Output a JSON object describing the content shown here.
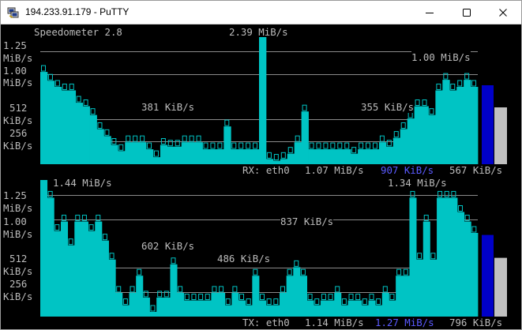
{
  "window": {
    "title": "194.233.91.179 - PuTTY",
    "icon": "putty-icon",
    "controls": [
      "minimize-icon",
      "maximize-icon",
      "close-icon"
    ]
  },
  "colors": {
    "background": "#000000",
    "text": "#bcbcbc",
    "bars": "#00c4c4",
    "gridline": "#8a8a8a",
    "meter_fill": "#0000c8",
    "meter_empty": "#c0c0c0",
    "highlight_blue": "#5555ff"
  },
  "header": {
    "app": "Speedometer 2.8",
    "peak": "2.39 MiB/s"
  },
  "scale_labels": {
    "rx": [
      "1.25",
      "MiB/s",
      "1.00",
      "MiB/s",
      "512",
      "KiB/s",
      "256",
      "KiB/s"
    ],
    "tx": [
      "1.25",
      "MiB/s",
      "1.00",
      "MiB/s",
      "512",
      "KiB/s",
      "256",
      "KiB/s"
    ]
  },
  "rx": {
    "annotations": [
      "381 KiB/s",
      "355 KiB/s",
      "1.00 MiB/s"
    ],
    "status": {
      "label": "RX: eth0",
      "current": "1.07 MiB/s",
      "average": "907 KiB/s",
      "min": "567 KiB/s"
    },
    "meter_level": 0.68
  },
  "tx": {
    "annotations": [
      "1.44 MiB/s",
      "1.34 MiB/s",
      "837 KiB/s",
      "602 KiB/s",
      "486 KiB/s"
    ],
    "status": {
      "label": "TX: eth0",
      "current": "1.14 MiB/s",
      "average": "1.27 MiB/s",
      "min": "796 KiB/s"
    },
    "meter_level": 0.65
  },
  "chart_data": [
    {
      "type": "bar",
      "name": "RX: eth0",
      "ylabel": "",
      "yticks": [
        "1.25 MiB/s",
        "1.00 MiB/s",
        "512 KiB/s",
        "256 KiB/s"
      ],
      "units": "KiB/s",
      "ylim": [
        0,
        1320
      ],
      "values": [
        1050,
        950,
        880,
        840,
        840,
        700,
        660,
        560,
        400,
        320,
        220,
        150,
        250,
        250,
        250,
        170,
        80,
        220,
        200,
        200,
        250,
        250,
        250,
        170,
        170,
        170,
        430,
        170,
        170,
        170,
        170,
        2448,
        60,
        40,
        60,
        120,
        250,
        600,
        170,
        170,
        170,
        170,
        170,
        170,
        120,
        170,
        170,
        170,
        250,
        200,
        300,
        400,
        520,
        660,
        660,
        560,
        840,
        960,
        840,
        880,
        960,
        880
      ]
    },
    {
      "type": "bar",
      "name": "TX: eth0",
      "ylabel": "",
      "yticks": [
        "1.25 MiB/s",
        "1.00 MiB/s",
        "512 KiB/s",
        "256 KiB/s"
      ],
      "units": "KiB/s",
      "ylim": [
        0,
        1320
      ],
      "values": [
        1474,
        1250,
        900,
        1000,
        750,
        1000,
        1000,
        900,
        1000,
        800,
        600,
        250,
        120,
        250,
        430,
        200,
        50,
        200,
        200,
        550,
        250,
        170,
        170,
        170,
        170,
        250,
        250,
        120,
        250,
        170,
        120,
        430,
        170,
        120,
        120,
        250,
        430,
        520,
        430,
        170,
        120,
        170,
        170,
        250,
        120,
        170,
        170,
        120,
        170,
        120,
        250,
        170,
        430,
        430,
        1250,
        600,
        1000,
        600,
        1250,
        1250,
        1250,
        1100,
        1000,
        880
      ]
    }
  ]
}
